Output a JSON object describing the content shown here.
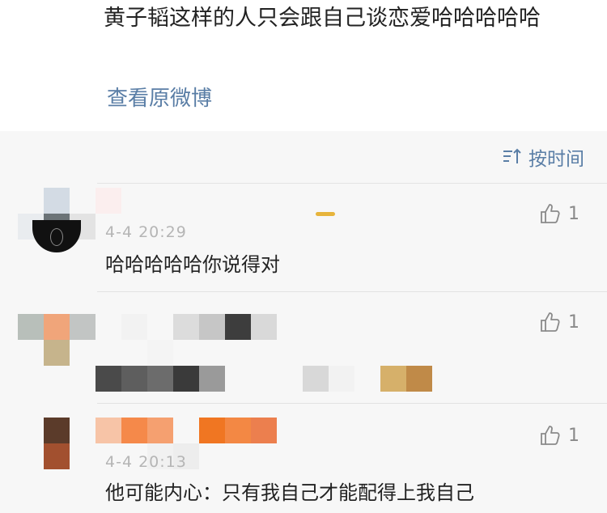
{
  "post": {
    "text": "黄子韬这样的人只会跟自己谈恋爱哈哈哈哈哈",
    "view_original_label": "查看原微博"
  },
  "sort": {
    "label": "按时间",
    "icon": "sort-icon"
  },
  "comments": [
    {
      "time": "4-4 20:29",
      "text": "哈哈哈哈哈你说得对",
      "likes": "1"
    },
    {
      "time": "",
      "text": "",
      "likes": "1"
    },
    {
      "time": "4-4 20:13",
      "text": "他可能内心：只有我自己才能配得上我自己",
      "likes": "1"
    }
  ],
  "colors": {
    "link": "#5a7ea6",
    "text": "#222222",
    "meta": "#b5b5b5",
    "background": "#f7f7f7"
  }
}
